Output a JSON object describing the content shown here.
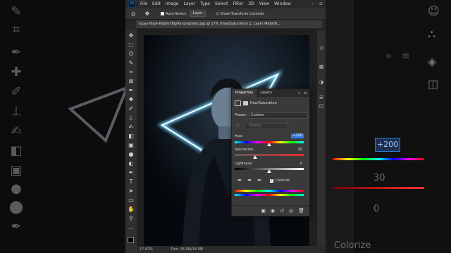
{
  "menu": {
    "logo": "Ps",
    "items": [
      "File",
      "Edit",
      "Image",
      "Layer",
      "Type",
      "Select",
      "Filter",
      "3D",
      "View",
      "Window"
    ]
  },
  "options": {
    "auto_select_label": "Auto-Select:",
    "auto_select_value": "Layer",
    "show_transform_label": "Show Transform Controls"
  },
  "document": {
    "tab_title": "lucas-filipe-Nlp0e7BqiKk-unsplash.jpg @ 17% (Hue/Saturation 1, Layer Mask/8..."
  },
  "status": {
    "zoom": "17.62%",
    "doc": "Doc: 26.9M/34.9M"
  },
  "properties": {
    "tab_properties": "Properties",
    "tab_layers": "Layers",
    "adjustment_name": "Hue/Saturation",
    "preset_label": "Preset:",
    "preset_value": "Custom",
    "channel_value": "Master",
    "hue_label": "Hue:",
    "hue_value": "+200",
    "saturation_label": "Saturation:",
    "saturation_value": "30",
    "lightness_label": "Lightness:",
    "lightness_value": "0",
    "colorize_label": "Colorize",
    "colorize_checked": true,
    "hue_fraction": 0.5,
    "saturation_fraction": 0.3,
    "lightness_fraction": 0.5
  },
  "background_panel": {
    "hue_value": "+200",
    "saturation_value": "30",
    "lightness_value": "0",
    "colorize_label": "Colorize"
  },
  "colors": {
    "app_bg": "#282828",
    "neon": "#ffffff",
    "neon_glow": "#6fd3ff",
    "highlight": "#2a7be0"
  }
}
